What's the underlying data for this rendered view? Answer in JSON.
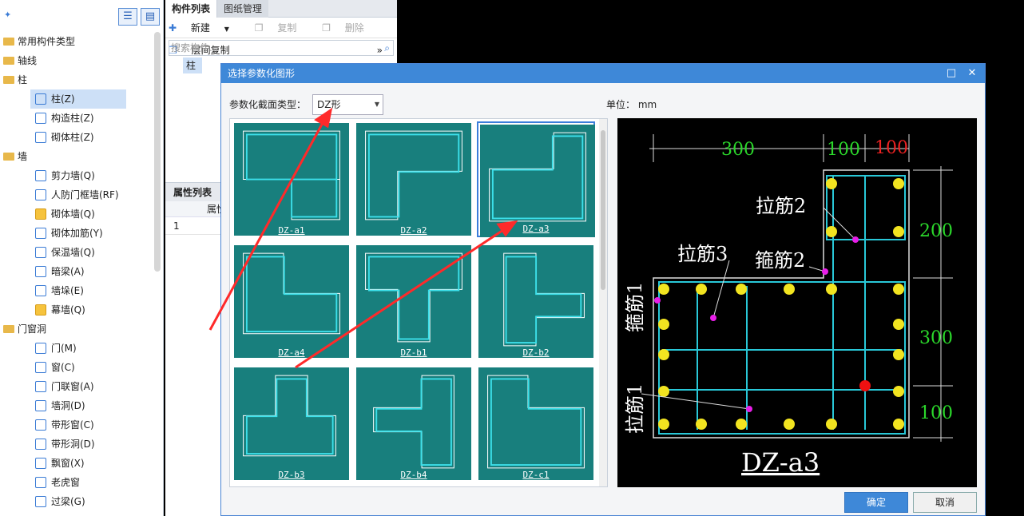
{
  "left": {
    "groups": [
      {
        "label": "常用构件类型",
        "children": []
      },
      {
        "label": "轴线",
        "children": []
      },
      {
        "label": "柱",
        "children": [
          "柱(Z)",
          "构造柱(Z)",
          "砌体柱(Z)"
        ]
      },
      {
        "label": "墙",
        "children": [
          "剪力墙(Q)",
          "人防门框墙(RF)",
          "砌体墙(Q)",
          "砌体加筋(Y)",
          "保温墙(Q)",
          "暗梁(A)",
          "墙垛(E)",
          "幕墙(Q)"
        ]
      },
      {
        "label": "门窗洞",
        "children": [
          "门(M)",
          "窗(C)",
          "门联窗(A)",
          "墙洞(D)",
          "带形窗(C)",
          "带形洞(D)",
          "飘窗(X)",
          "老虎窗",
          "过梁(G)"
        ]
      }
    ],
    "selected": "柱(Z)"
  },
  "mid": {
    "tabs": [
      "构件列表",
      "图纸管理"
    ],
    "toolbar": {
      "new": "新建",
      "copy": "复制",
      "delete": "删除",
      "floor_copy": "层间复制"
    },
    "search_placeholder": "搜索构件...",
    "list_item": "柱",
    "prop_tab": "属性列表",
    "prop_header": "属性",
    "prop_row_num": "1"
  },
  "dialog": {
    "title": "选择参数化图形",
    "section_label": "参数化截面类型：",
    "section_value": "DZ形",
    "unit_label": "单位：",
    "unit_value": "mm",
    "thumbs": [
      "DZ-a1",
      "DZ-a2",
      "DZ-a3",
      "DZ-a4",
      "DZ-b1",
      "DZ-b2",
      "DZ-b3",
      "DZ-b4",
      "DZ-c1"
    ],
    "selected_thumb": "DZ-a3",
    "ok": "确定",
    "cancel": "取消",
    "preview": {
      "dims_top": [
        "300",
        "100",
        "100"
      ],
      "dims_right": [
        "200",
        "300",
        "100"
      ],
      "labels": [
        "拉筋2",
        "拉筋3",
        "箍筋2",
        "箍筋1",
        "拉筋1"
      ],
      "name": "DZ-a3"
    }
  }
}
